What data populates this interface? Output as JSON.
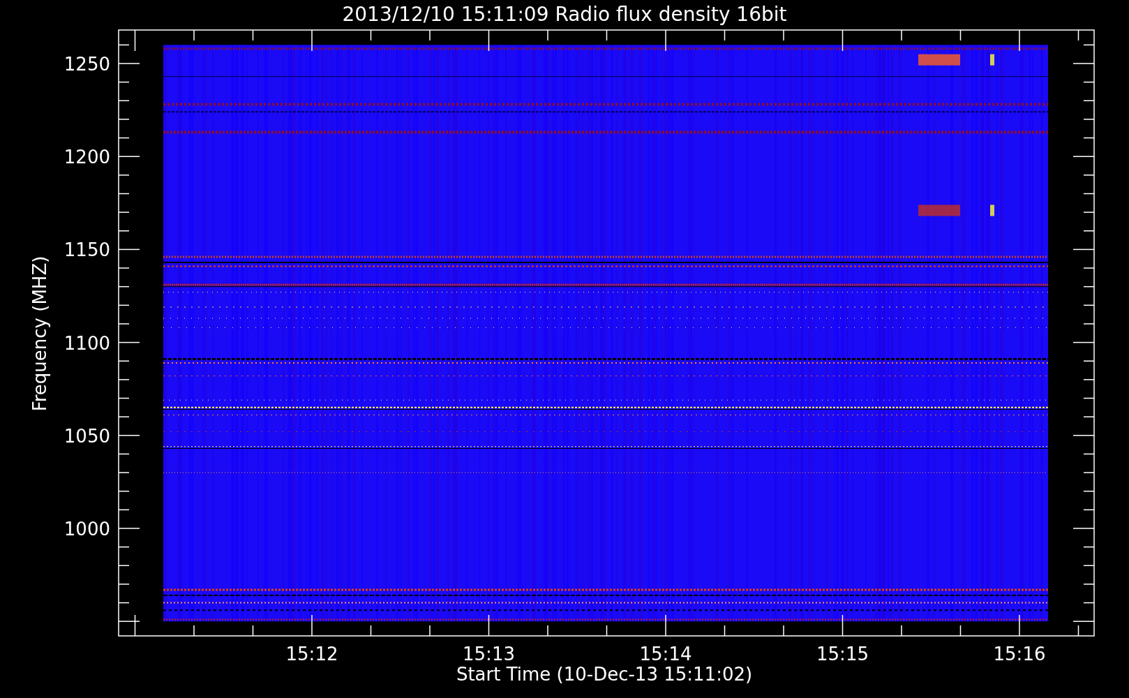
{
  "plot": {
    "title": "2013/12/10 15:11:09 Radio flux density 16bit",
    "ylabel": "Frequency (MHZ)",
    "xlabel": "Start Time (10-Dec-13 15:11:02)",
    "yticks": [
      "1250",
      "1200",
      "1150",
      "1100",
      "1050",
      "1000"
    ],
    "xticks": [
      "15:12",
      "15:13",
      "15:14",
      "15:15",
      "15:16"
    ]
  }
}
